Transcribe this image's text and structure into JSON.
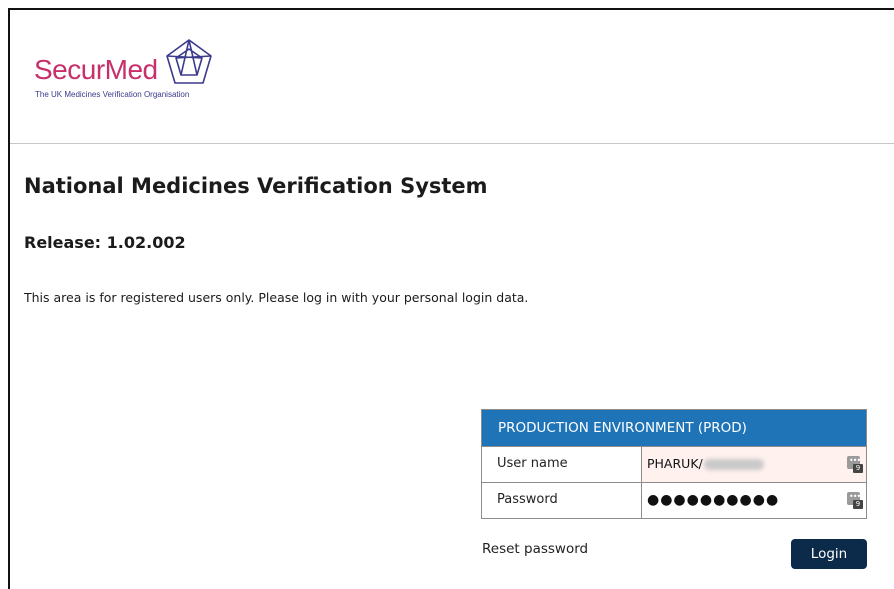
{
  "branding": {
    "logo_text": "SecurMed",
    "tagline": "The UK Medicines Verification Organisation"
  },
  "page": {
    "title": "National Medicines Verification System",
    "release": "Release: 1.02.002",
    "intro": "This area is for registered users only. Please log in with your personal login data."
  },
  "login": {
    "environment": "PRODUCTION ENVIRONMENT (PROD)",
    "username_label": "User name",
    "username_value": "PHARUK/",
    "password_label": "Password",
    "password_value": "●●●●●●●●●●",
    "reset_label": "Reset password",
    "login_label": "Login",
    "pm_icon_dots": "•••",
    "pm_icon_badge": "9"
  },
  "colors": {
    "brand_pink": "#c7306b",
    "tagline_blue": "#3b3a8c",
    "header_blue": "#1f74b8",
    "button_navy": "#0c2a4a",
    "username_bg": "#fff1ee"
  },
  "icons": [
    "securmed-logo-icon",
    "password-manager-icon"
  ]
}
